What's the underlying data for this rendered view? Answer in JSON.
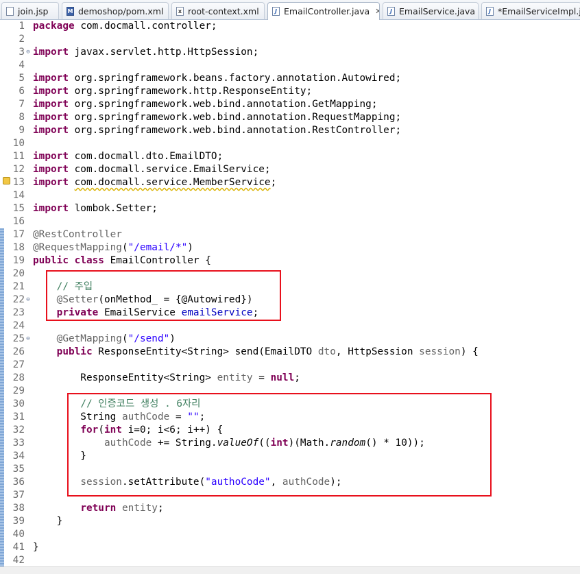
{
  "tabs": [
    {
      "label": "join.jsp",
      "icon": "jsp-file-icon"
    },
    {
      "label": "demoshop/pom.xml",
      "icon": "maven-pom-icon"
    },
    {
      "label": "root-context.xml",
      "icon": "xml-file-icon"
    },
    {
      "label": "EmailController.java",
      "icon": "java-file-icon",
      "active": true,
      "close": "✕"
    },
    {
      "label": "EmailService.java",
      "icon": "java-file-icon"
    },
    {
      "label": "*EmailServiceImpl.java",
      "icon": "java-file-icon"
    }
  ],
  "code": {
    "lines": [
      [
        {
          "t": "package",
          "c": "kw"
        },
        {
          "t": " com.docmall.controller;"
        }
      ],
      [],
      [
        {
          "t": "import",
          "c": "kw"
        },
        {
          "t": " javax.servlet.http.HttpSession;"
        }
      ],
      [],
      [
        {
          "t": "import",
          "c": "kw"
        },
        {
          "t": " org.springframework.beans.factory.annotation.Autowired;"
        }
      ],
      [
        {
          "t": "import",
          "c": "kw"
        },
        {
          "t": " org.springframework.http.ResponseEntity;"
        }
      ],
      [
        {
          "t": "import",
          "c": "kw"
        },
        {
          "t": " org.springframework.web.bind.annotation.GetMapping;"
        }
      ],
      [
        {
          "t": "import",
          "c": "kw"
        },
        {
          "t": " org.springframework.web.bind.annotation.RequestMapping;"
        }
      ],
      [
        {
          "t": "import",
          "c": "kw"
        },
        {
          "t": " org.springframework.web.bind.annotation.RestController;"
        }
      ],
      [],
      [
        {
          "t": "import",
          "c": "kw"
        },
        {
          "t": " com.docmall.dto.EmailDTO;"
        }
      ],
      [
        {
          "t": "import",
          "c": "kw"
        },
        {
          "t": " com.docmall.service.EmailService;"
        }
      ],
      [
        {
          "t": "import",
          "c": "kw"
        },
        {
          "t": " "
        },
        {
          "t": "com.docmall.service.MemberService",
          "c": "warn"
        },
        {
          "t": ";"
        }
      ],
      [],
      [
        {
          "t": "import",
          "c": "kw"
        },
        {
          "t": " lombok.Setter;"
        }
      ],
      [],
      [
        {
          "t": "@RestController",
          "c": "an"
        }
      ],
      [
        {
          "t": "@RequestMapping",
          "c": "an"
        },
        {
          "t": "("
        },
        {
          "t": "\"/email/*\"",
          "c": "st"
        },
        {
          "t": ")"
        }
      ],
      [
        {
          "t": "public",
          "c": "kw"
        },
        {
          "t": " "
        },
        {
          "t": "class",
          "c": "kw"
        },
        {
          "t": " EmailController {"
        }
      ],
      [],
      [
        {
          "t": "    "
        },
        {
          "t": "// 주입",
          "c": "cm"
        }
      ],
      [
        {
          "t": "    "
        },
        {
          "t": "@Setter",
          "c": "an"
        },
        {
          "t": "(onMethod_ = {@Autowired})"
        }
      ],
      [
        {
          "t": "    "
        },
        {
          "t": "private",
          "c": "kw"
        },
        {
          "t": " EmailService "
        },
        {
          "t": "emailService",
          "c": "fd"
        },
        {
          "t": ";"
        }
      ],
      [],
      [
        {
          "t": "    "
        },
        {
          "t": "@GetMapping",
          "c": "an"
        },
        {
          "t": "("
        },
        {
          "t": "\"/send\"",
          "c": "st"
        },
        {
          "t": ")"
        }
      ],
      [
        {
          "t": "    "
        },
        {
          "t": "public",
          "c": "kw"
        },
        {
          "t": " ResponseEntity<String> send(EmailDTO "
        },
        {
          "t": "dto",
          "c": "an"
        },
        {
          "t": ", HttpSession "
        },
        {
          "t": "session",
          "c": "an"
        },
        {
          "t": ") {"
        }
      ],
      [],
      [
        {
          "t": "        ResponseEntity<String> "
        },
        {
          "t": "entity",
          "c": "an"
        },
        {
          "t": " = "
        },
        {
          "t": "null",
          "c": "kw"
        },
        {
          "t": ";"
        }
      ],
      [],
      [
        {
          "t": "        "
        },
        {
          "t": "// 인증코드 생성 . 6자리",
          "c": "cm"
        }
      ],
      [
        {
          "t": "        String "
        },
        {
          "t": "authCode",
          "c": "an"
        },
        {
          "t": " = "
        },
        {
          "t": "\"\"",
          "c": "st"
        },
        {
          "t": ";"
        }
      ],
      [
        {
          "t": "        "
        },
        {
          "t": "for",
          "c": "kw"
        },
        {
          "t": "("
        },
        {
          "t": "int",
          "c": "kw"
        },
        {
          "t": " i=0; i<6; i++) {"
        }
      ],
      [
        {
          "t": "            "
        },
        {
          "t": "authCode",
          "c": "an"
        },
        {
          "t": " += String."
        },
        {
          "t": "valueOf",
          "c": "it"
        },
        {
          "t": "(("
        },
        {
          "t": "int",
          "c": "kw"
        },
        {
          "t": ")(Math."
        },
        {
          "t": "random",
          "c": "it"
        },
        {
          "t": "() * 10));"
        }
      ],
      [
        {
          "t": "        }"
        }
      ],
      [],
      [
        {
          "t": "        "
        },
        {
          "t": "session",
          "c": "an"
        },
        {
          "t": ".setAttribute("
        },
        {
          "t": "\"authoCode\"",
          "c": "st"
        },
        {
          "t": ", "
        },
        {
          "t": "authCode",
          "c": "an"
        },
        {
          "t": ");"
        }
      ],
      [],
      [
        {
          "t": "        "
        },
        {
          "t": "return",
          "c": "kw"
        },
        {
          "t": " "
        },
        {
          "t": "entity",
          "c": "an"
        },
        {
          "t": ";"
        }
      ],
      [
        {
          "t": "    }"
        }
      ],
      [],
      [
        {
          "t": "}"
        }
      ],
      []
    ],
    "fold_lines": [
      3,
      22,
      25
    ]
  }
}
